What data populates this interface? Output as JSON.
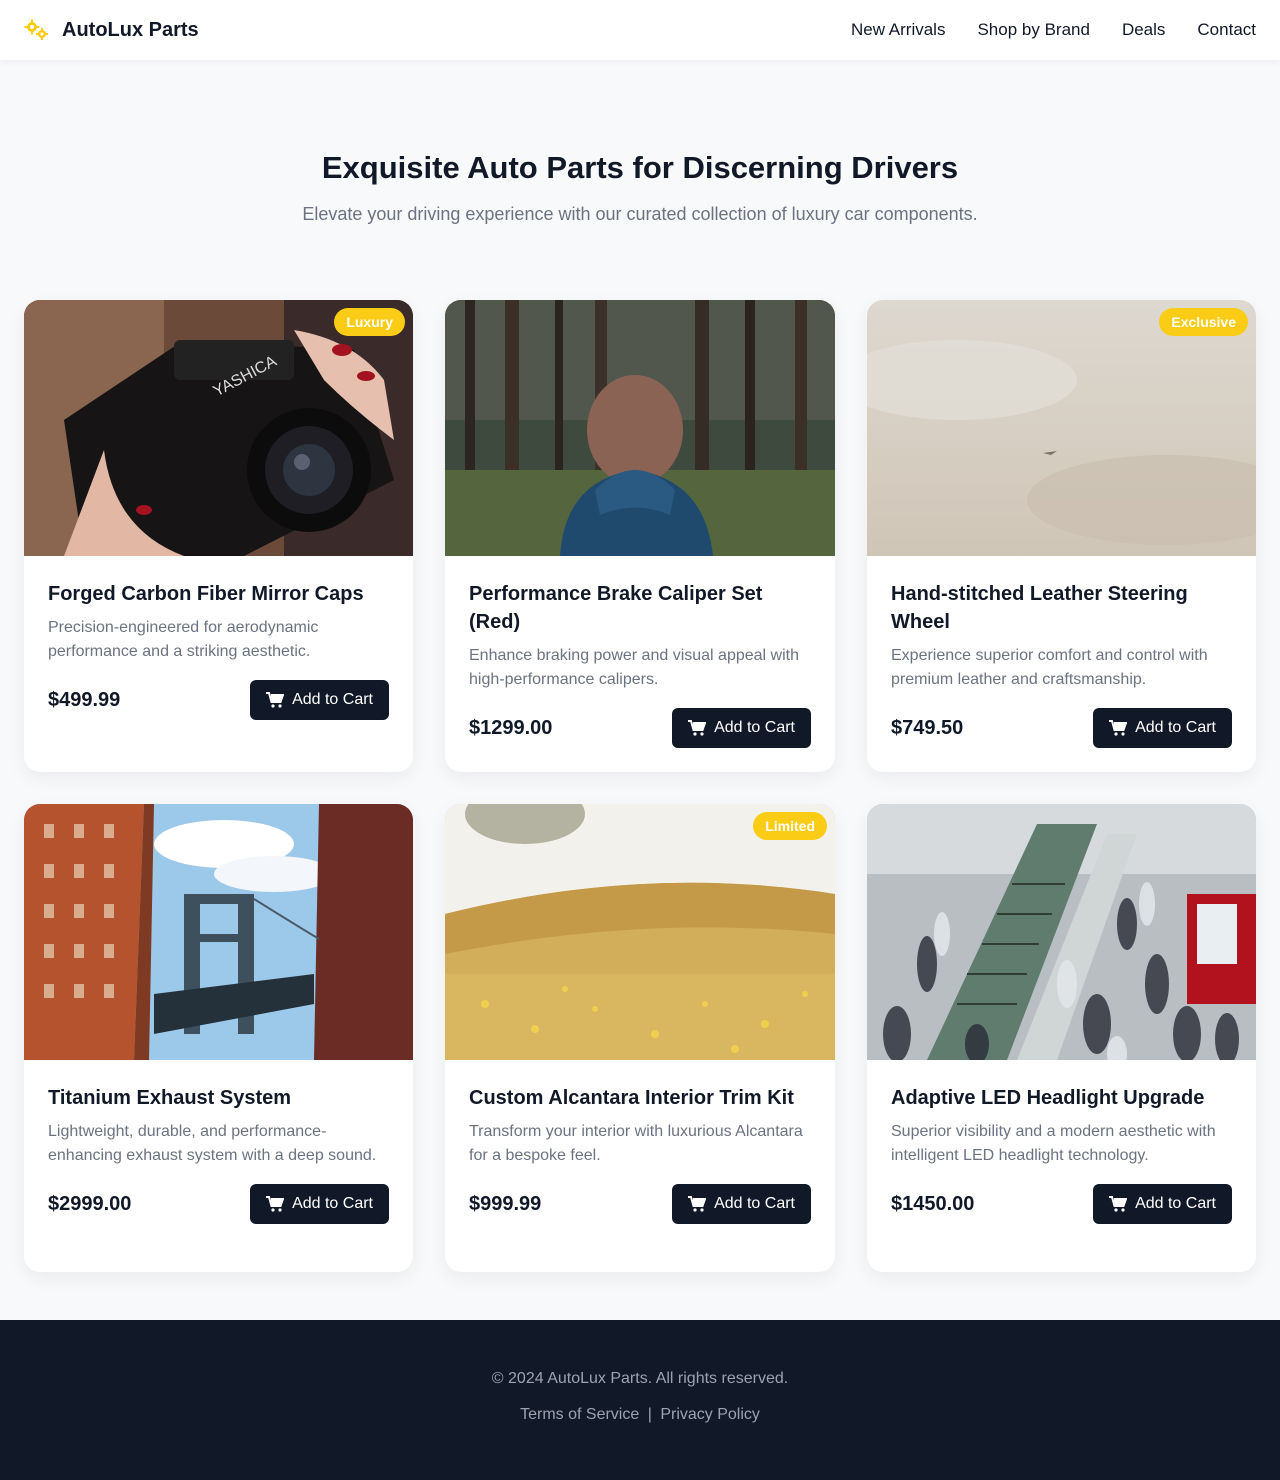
{
  "header": {
    "brand": "AutoLux Parts",
    "nav": [
      "New Arrivals",
      "Shop by Brand",
      "Deals",
      "Contact"
    ]
  },
  "hero": {
    "title": "Exquisite Auto Parts for Discerning Drivers",
    "subtitle": "Elevate your driving experience with our curated collection of luxury car components."
  },
  "products": [
    {
      "title": "Forged Carbon Fiber Mirror Caps",
      "desc": "Precision-engineered for aerodynamic performance and a striking aesthetic.",
      "price": "$499.99",
      "badge": "Luxury",
      "button": "Add to Cart",
      "image": "hand holding camera"
    },
    {
      "title": "Performance Brake Caliper Set (Red)",
      "desc": "Enhance braking power and visual appeal with high-performance calipers.",
      "price": "$1299.00",
      "badge": "",
      "button": "Add to Cart",
      "image": "person in forest"
    },
    {
      "title": "Hand-stitched Leather Steering Wheel",
      "desc": "Experience superior comfort and control with premium leather and craftsmanship.",
      "price": "$749.50",
      "badge": "Exclusive",
      "button": "Add to Cart",
      "image": "hazy sky"
    },
    {
      "title": "Titanium Exhaust System",
      "desc": "Lightweight, durable, and performance-enhancing exhaust system with a deep sound.",
      "price": "$2999.00",
      "badge": "",
      "button": "Add to Cart",
      "image": "bridge between buildings"
    },
    {
      "title": "Custom Alcantara Interior Trim Kit",
      "desc": "Transform your interior with luxurious Alcantara for a bespoke feel.",
      "price": "$999.99",
      "badge": "Limited",
      "button": "Add to Cart",
      "image": "yellow flower field"
    },
    {
      "title": "Adaptive LED Headlight Upgrade",
      "desc": "Superior visibility and a modern aesthetic with intelligent LED headlight technology.",
      "price": "$1450.00",
      "badge": "",
      "button": "Add to Cart",
      "image": "crowded escalator"
    }
  ],
  "footer": {
    "copyright": "© 2024 AutoLux Parts. All rights reserved.",
    "links": [
      "Terms of Service",
      "Privacy Policy"
    ],
    "separator": "|"
  },
  "colors": {
    "accent": "#facc15",
    "dark": "#111827",
    "muted": "#6b7280"
  }
}
